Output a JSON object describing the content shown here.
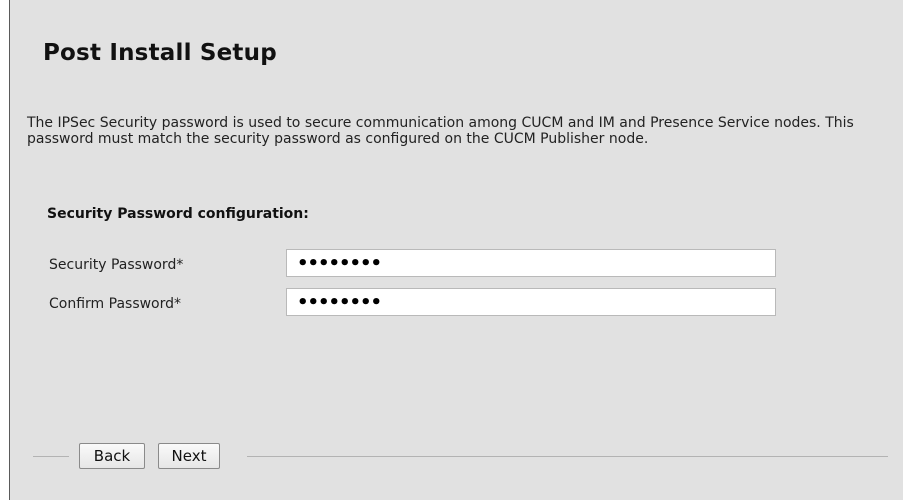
{
  "page": {
    "title": "Post Install Setup",
    "description": "The IPSec Security password is used to secure communication among CUCM and IM and Presence Service nodes. This password must match the security password as configured on the CUCM Publisher node."
  },
  "form": {
    "section_heading": "Security Password configuration:",
    "security_password": {
      "label": "Security Password*",
      "value": "••••••••"
    },
    "confirm_password": {
      "label": "Confirm Password*",
      "value": "••••••••"
    }
  },
  "footer": {
    "back_label": "Back",
    "next_label": "Next"
  }
}
